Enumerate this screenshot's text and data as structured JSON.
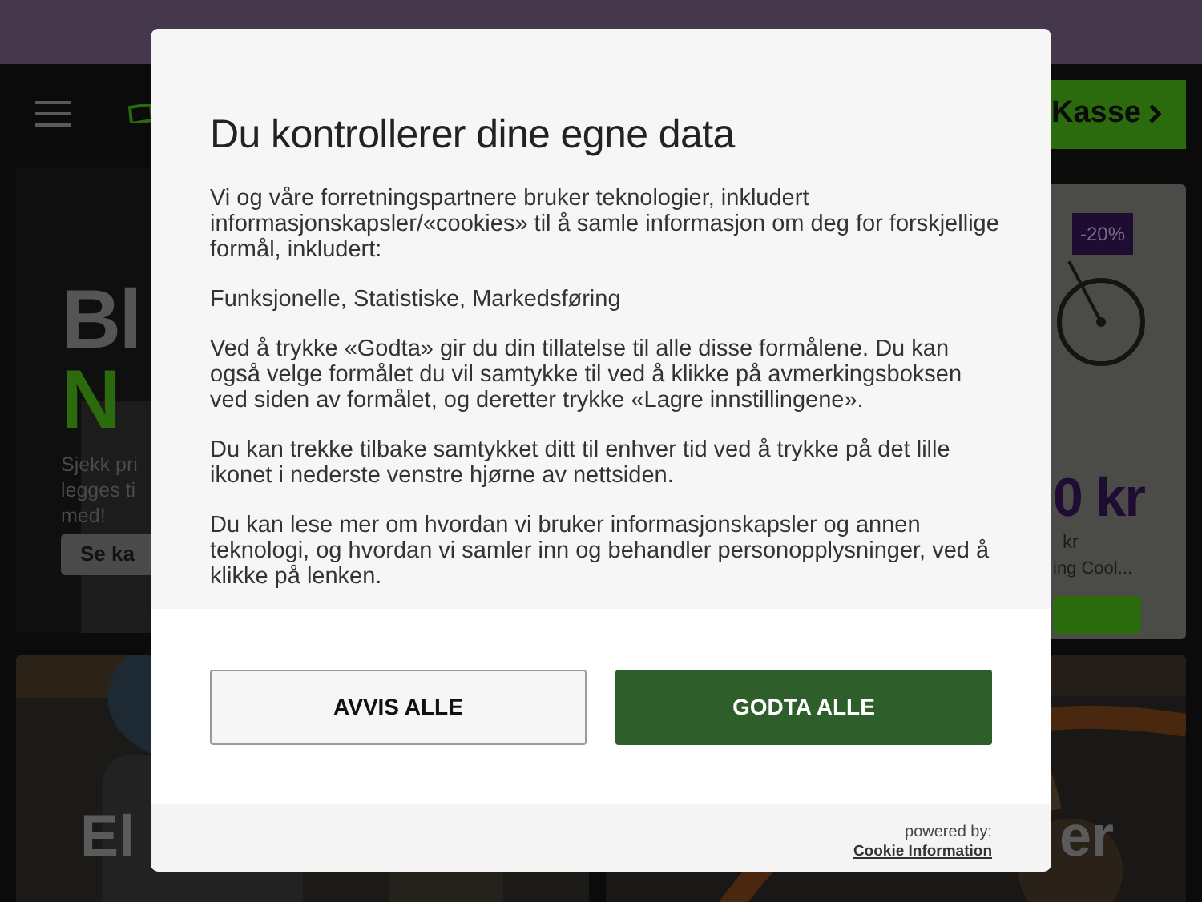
{
  "header": {
    "cart_button": "Kasse"
  },
  "hero": {
    "title_1": "Bl",
    "title_2": "N",
    "lines": [
      "Sjekk pri",
      "legges ti",
      "med!"
    ],
    "button": "Se ka"
  },
  "product": {
    "badge": "-20%",
    "price": "0 kr",
    "old_price": "kr",
    "name": "ing Cool..."
  },
  "tiles": [
    {
      "title": "El"
    },
    {
      "title": "er"
    }
  ],
  "consent": {
    "title": "Du kontrollerer dine egne data",
    "paragraphs": [
      "Vi og våre forretningspartnere bruker teknologier, inkludert informasjonskapsler/«cookies» til å samle informasjon om deg for forskjellige formål, inkludert:",
      "Funksjonelle, Statistiske, Markedsføring",
      "Ved å trykke «Godta» gir du din tillatelse til alle disse formålene. Du kan også velge formålet du vil samtykke til ved å klikke på avmerkingsboksen ved siden av formålet, og deretter trykke «Lagre innstillingene».",
      "Du kan trekke tilbake samtykket ditt til enhver tid ved å trykke på det lille ikonet i nederste venstre hjørne av nettsiden.",
      "Du kan lese mer om hvordan vi bruker informasjonskapsler og annen teknologi, og hvordan vi samler inn og behandler personopplysninger, ved å klikke på lenken."
    ],
    "buttons": [
      {
        "label": "AVVIS ALLE",
        "kind": "reject"
      },
      {
        "label": "GODTA ALLE",
        "kind": "accept"
      }
    ],
    "powered_by": "powered by:",
    "provider_link": "Cookie Information"
  }
}
